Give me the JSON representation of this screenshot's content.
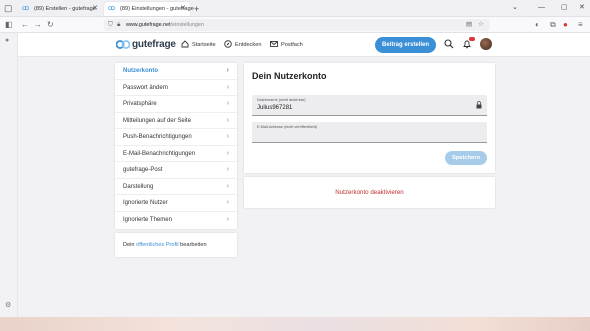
{
  "browser": {
    "tabs": [
      {
        "title": "(89) Erstellen - gutefrage",
        "active": false
      },
      {
        "title": "(89) Einstellungen - gutefrage",
        "active": true
      }
    ],
    "url_domain": "www.gutefrage.net",
    "url_path": "/einstellungen"
  },
  "site": {
    "logo_text": "gutefrage",
    "nav": [
      {
        "label": "Startseite",
        "icon": "home-icon"
      },
      {
        "label": "Entdecken",
        "icon": "compass-icon"
      },
      {
        "label": "Postfach",
        "icon": "mail-icon"
      }
    ],
    "cta_label": "Beitrag erstellen",
    "notification_count": "89",
    "accent_color": "#3a8fd6"
  },
  "sidebar": {
    "items": [
      {
        "label": "Nutzerkonto",
        "active": true
      },
      {
        "label": "Passwort ändern",
        "active": false
      },
      {
        "label": "Privatsphäre",
        "active": false
      },
      {
        "label": "Mitteilungen auf der Seite",
        "active": false
      },
      {
        "label": "Push-Benachrichtigungen",
        "active": false
      },
      {
        "label": "E-Mail-Benachrichtigungen",
        "active": false
      },
      {
        "label": "gutefrage-Post",
        "active": false
      },
      {
        "label": "Darstellung",
        "active": false
      },
      {
        "label": "Ignorierte Nutzer",
        "active": false
      },
      {
        "label": "Ignorierte Themen",
        "active": false
      }
    ],
    "profile_prefix": "Dein",
    "profile_link": "öffentliches Profil",
    "profile_suffix": "bearbeiten"
  },
  "account": {
    "title": "Dein Nutzerkonto",
    "username_label": "Nutzername (nicht änderbar)",
    "username_value": "Julius967281",
    "email_label": "E-Mail-Adresse (nicht veröffentlicht)",
    "email_value": "",
    "save_label": "Speichern",
    "deactivate_label": "Nutzerkonto deaktivieren"
  }
}
